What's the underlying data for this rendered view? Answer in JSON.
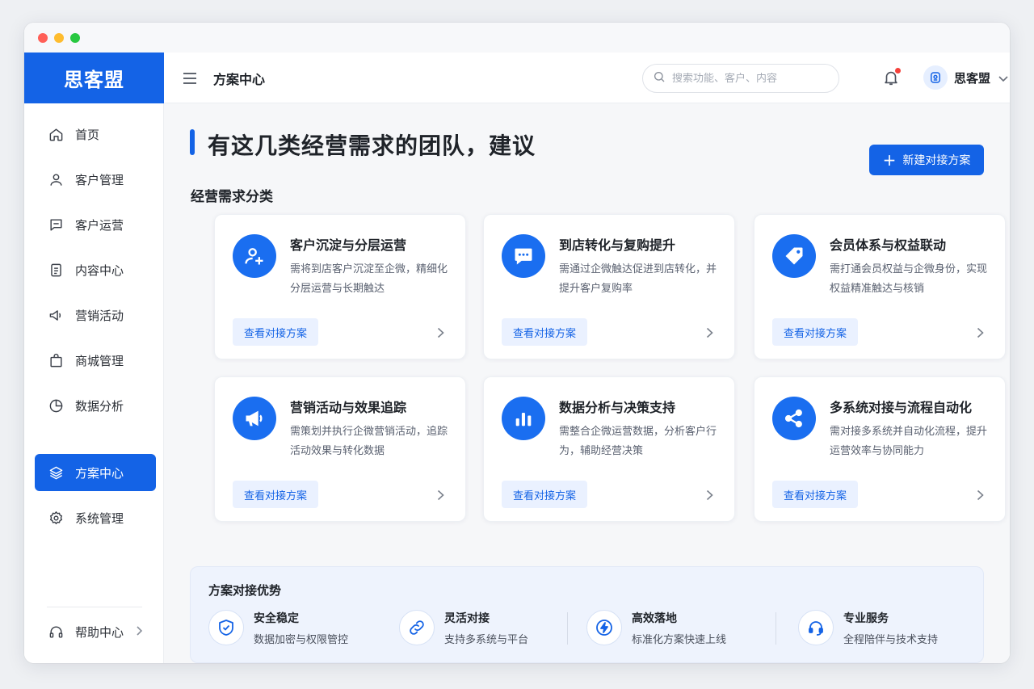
{
  "brand": "思客盟",
  "sidebar": {
    "items": [
      {
        "label": "首页",
        "icon": "home-icon"
      },
      {
        "label": "客户管理",
        "icon": "user-icon"
      },
      {
        "label": "客户运营",
        "icon": "chat-icon"
      },
      {
        "label": "内容中心",
        "icon": "document-icon"
      },
      {
        "label": "营销活动",
        "icon": "megaphone-icon"
      },
      {
        "label": "商城管理",
        "icon": "shopping-bag-icon"
      },
      {
        "label": "数据分析",
        "icon": "pie-chart-icon"
      },
      {
        "label": "方案中心",
        "icon": "layers-icon",
        "active": true
      },
      {
        "label": "系统管理",
        "icon": "gear-icon"
      }
    ],
    "help": "帮助中心"
  },
  "header": {
    "title": "方案中心",
    "search_placeholder": "搜索功能、客户、内容",
    "user_name": "思客盟"
  },
  "main": {
    "hero_title": "有这几类经营需求的团队，建议",
    "new_button": "新建对接方案",
    "section_label": "经营需求分类",
    "cards": [
      {
        "title": "客户沉淀与分层运营",
        "desc": "需将到店客户沉淀至企微，精细化分层运营与长期触达",
        "link": "查看对接方案",
        "icon": "add-user-icon"
      },
      {
        "title": "到店转化与复购提升",
        "desc": "需通过企微触达促进到店转化，并提升客户复购率",
        "link": "查看对接方案",
        "icon": "message-icon"
      },
      {
        "title": "会员体系与权益联动",
        "desc": "需打通会员权益与企微身份，实现权益精准触达与核销",
        "link": "查看对接方案",
        "icon": "tag-icon"
      },
      {
        "title": "营销活动与效果追踪",
        "desc": "需策划并执行企微营销活动，追踪活动效果与转化数据",
        "link": "查看对接方案",
        "icon": "megaphone-icon"
      },
      {
        "title": "数据分析与决策支持",
        "desc": "需整合企微运营数据，分析客户行为，辅助经营决策",
        "link": "查看对接方案",
        "icon": "bar-chart-icon"
      },
      {
        "title": "多系统对接与流程自动化",
        "desc": "需对接多系统并自动化流程，提升运营效率与协同能力",
        "link": "查看对接方案",
        "icon": "share-icon"
      }
    ],
    "advantages": {
      "title": "方案对接优势",
      "items": [
        {
          "title": "安全稳定",
          "desc": "数据加密与权限管控",
          "icon": "shield-check-icon"
        },
        {
          "title": "灵活对接",
          "desc": "支持多系统与平台",
          "icon": "link-icon"
        },
        {
          "title": "高效落地",
          "desc": "标准化方案快速上线",
          "icon": "lightning-icon"
        },
        {
          "title": "专业服务",
          "desc": "全程陪伴与技术支持",
          "icon": "headset-icon"
        }
      ]
    }
  },
  "colors": {
    "primary": "#1463e6",
    "accent_bg": "#eaf1ff",
    "notification": "#f5413b"
  }
}
